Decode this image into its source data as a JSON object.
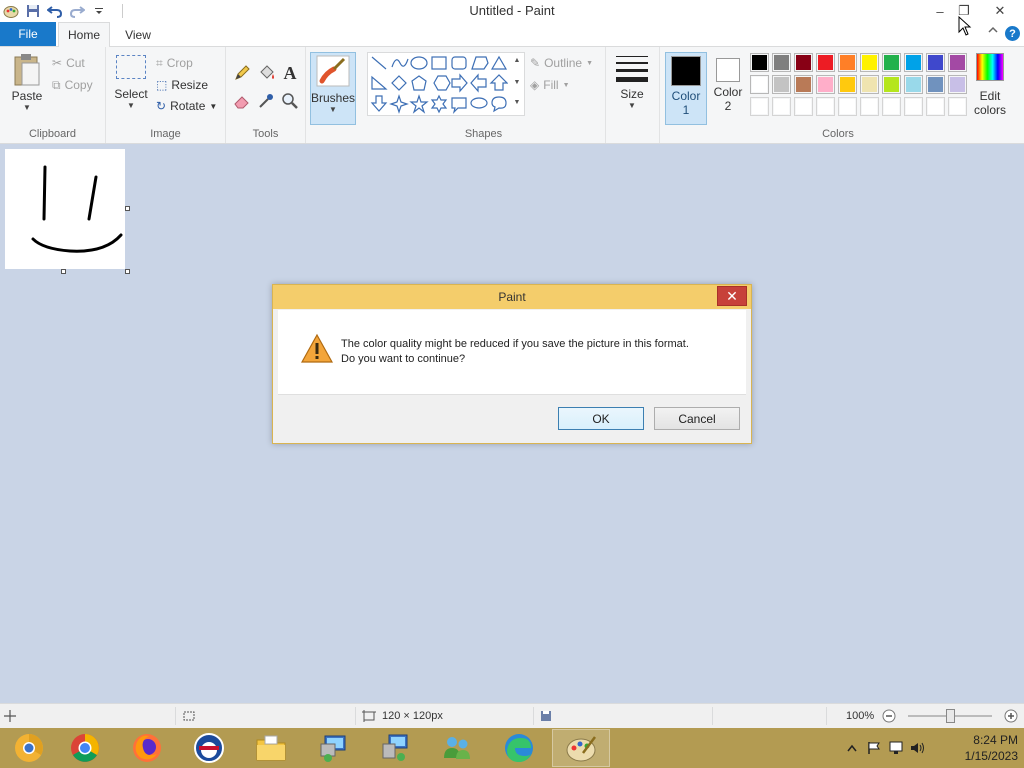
{
  "window": {
    "title": "Untitled - Paint",
    "minimize_glyph": "–",
    "restore_glyph": "❐",
    "close_glyph": "✕"
  },
  "ribbon_tabs": {
    "file": "File",
    "home": "Home",
    "view": "View"
  },
  "clipboard": {
    "paste": "Paste",
    "cut": "Cut",
    "copy": "Copy",
    "group_label": "Clipboard"
  },
  "image": {
    "select": "Select",
    "crop": "Crop",
    "resize": "Resize",
    "rotate": "Rotate",
    "group_label": "Image"
  },
  "tools": {
    "group_label": "Tools",
    "items": [
      "pencil-icon",
      "fill-icon",
      "text-icon",
      "eraser-icon",
      "color-picker-icon",
      "magnifier-icon"
    ]
  },
  "brushes": {
    "label": "Brushes"
  },
  "shapes": {
    "group_label": "Shapes",
    "outline": "Outline",
    "fill": "Fill"
  },
  "size": {
    "label": "Size"
  },
  "colors": {
    "group_label": "Colors",
    "color1_line1": "Color",
    "color1_line2": "1",
    "color2_line1": "Color",
    "color2_line2": "2",
    "color1_value": "#000000",
    "color2_value": "#ffffff",
    "edit_line1": "Edit",
    "edit_line2": "colors",
    "palette_row1": [
      "#000000",
      "#7f7f7f",
      "#880015",
      "#ed1c24",
      "#ff7f27",
      "#fff200",
      "#22b14c",
      "#00a2e8",
      "#3f48cc",
      "#a349a4"
    ],
    "palette_row2": [
      "#ffffff",
      "#c3c3c3",
      "#b97a57",
      "#ffaec9",
      "#ffc90e",
      "#efe4b0",
      "#b5e61d",
      "#99d9ea",
      "#7092be",
      "#c8bfe7"
    ],
    "palette_row3": [
      "#ffffff",
      "#ffffff",
      "#ffffff",
      "#ffffff",
      "#ffffff",
      "#ffffff",
      "#ffffff",
      "#ffffff",
      "#ffffff",
      "#ffffff"
    ]
  },
  "dialog": {
    "title": "Paint",
    "message_line1": "The color quality might be reduced if you save the picture in this format.",
    "message_line2": "Do you want to continue?",
    "ok": "OK",
    "cancel": "Cancel"
  },
  "statusbar": {
    "image_size": "120 × 120px",
    "zoom": "100%",
    "zoom_level": 0.5
  },
  "taskbar": {
    "apps": [
      "chrome-canary-icon",
      "chrome-icon",
      "firefox-icon",
      "opera-icon",
      "file-explorer-icon",
      "remote-desktop-icon",
      "network-icon",
      "users-icon",
      "edge-icon",
      "paint-icon"
    ],
    "time": "8:24 PM",
    "date": "1/15/2023"
  }
}
